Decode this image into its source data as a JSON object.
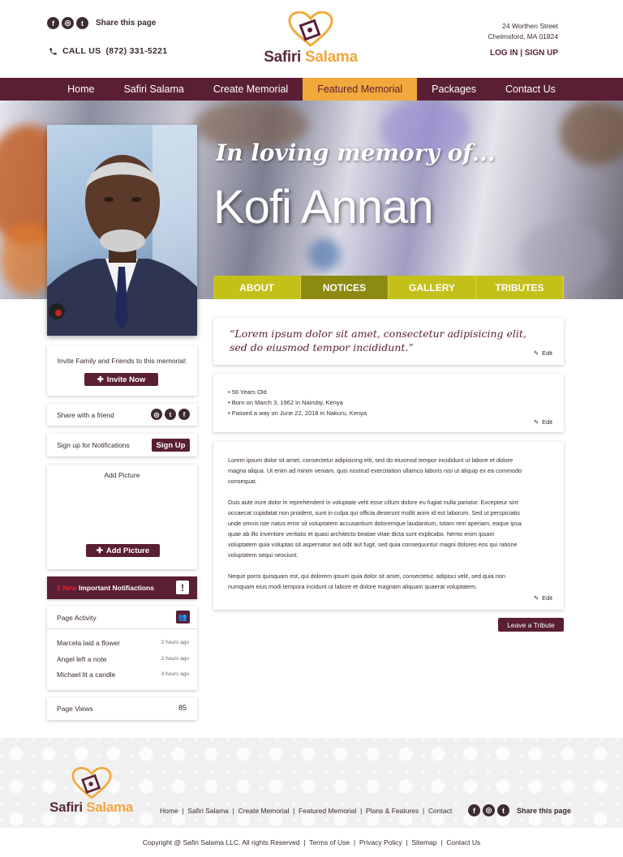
{
  "header": {
    "share_label": "Share this page",
    "call_label": "CALL US",
    "phone": "(872) 331-5221",
    "logo_word1": "Safiri",
    "logo_word2": "Salama",
    "address_line1": "24 Worthen Street",
    "address_line2": "Chelmsford, MA 01824",
    "login": "LOG IN",
    "signup": "SIGN UP",
    "separator": "|"
  },
  "social": [
    {
      "icon": "facebook-icon",
      "glyph": "f"
    },
    {
      "icon": "instagram-icon",
      "glyph": "◎"
    },
    {
      "icon": "twitter-icon",
      "glyph": "t"
    }
  ],
  "nav": {
    "items": [
      {
        "label": "Home"
      },
      {
        "label": "Safiri Salama"
      },
      {
        "label": "Create Memorial"
      },
      {
        "label": "Featured Memorial",
        "active": true
      },
      {
        "label": "Packages"
      },
      {
        "label": "Contact Us"
      }
    ]
  },
  "hero": {
    "memory_text": "In loving memory of...",
    "name": "Kofi Annan"
  },
  "tabs": [
    {
      "label": "ABOUT"
    },
    {
      "label": "NOTICES",
      "active": true
    },
    {
      "label": "GALLERY"
    },
    {
      "label": "TRIBUTES"
    }
  ],
  "sidebar": {
    "invite_text": "Invite Family and Friends to this memorial:",
    "invite_button": "Invite Now",
    "share_friend": "Share with a friend",
    "notify_text": "Sign up for Notifications",
    "notify_button": "Sign Up",
    "add_picture_title": "Add Picture",
    "add_picture_button": "Add Picture",
    "notifications_count": "2 New",
    "notifications_label": "Important Notifiactions",
    "activity_title": "Page Activity",
    "activity": [
      {
        "text": "Marcela laid a flower",
        "time": "2 hours ago"
      },
      {
        "text": "Angel left a note",
        "time": "2 hours ago"
      },
      {
        "text": "Michael lit a candle",
        "time": "3 hours ago"
      }
    ],
    "views_label": "Page Views",
    "views_count": "85"
  },
  "main": {
    "quote": "“Lorem ipsum dolor sit amet, consectetur adipisicing elit, sed do eiusmod tempor incididunt.”",
    "edit_label": "Edit",
    "facts": [
      "56 Years Old",
      "Born on March 3, 1962 in Nairoby, Kenya",
      "Passed a way on June 22, 2018 in Nakuru, Kenya"
    ],
    "paragraphs": [
      "Lorem ipsum dolor sit amet, consectetur adipisicing elit, sed do eiusmod tempor incididunt ut labore et dolore magna aliqua. Ut enim ad minim veniam, quis nostrud exercitation ullamco laboris nisi ut aliquip ex ea commodo consequat.",
      "Duis aute irure dolor in reprehenderit in voluptate velit esse cillum dolore eu fugiat nulla pariatur. Excepteur sint occaecat cupidatat non proident, sunt in culpa qui officia deserunt mollit anim id est laborum. Sed ut perspiciatis unde omnis iste natus error sit voluptatem accusantium doloremque laudantium, totam rem aperiam, eaque ipsa quae ab illo inventore veritatis et quasi architecto beatae vitae dicta sunt explicabo. Nemo enim ipsam voluptatem quia voluptas sit aspernatur aut odit aut fugit, sed quia consequuntur magni dolores eos qui ratione voluptatem sequi nesciunt.",
      "Neque porro quisquam est, qui dolorem ipsum quia dolor sit amet, consectetur, adipisci velit, sed quia non numquam eius modi tempora incidunt ut labore et dolore magnam aliquam quaerat voluptatem."
    ],
    "tribute_button": "Leave a Tribute"
  },
  "footer": {
    "links": [
      "Home",
      "Safiri Salama",
      "Create Memorial",
      "Featured Memorial",
      "Plans & Features",
      "Contact"
    ],
    "share_label": "Share this page",
    "copyright": "Copyright @ Safiri Salama LLC. All rights Reserved",
    "bottom_links": [
      "Terms of Use",
      "Privacy Policy",
      "Sitemap",
      "Contact Us"
    ]
  },
  "colors": {
    "brand_plum": "#5a1f35",
    "brand_orange": "#f2a93b",
    "tab_olive": "#c4c01a",
    "tab_olive_active": "#8c8a10",
    "alert_red": "#e8202a"
  }
}
